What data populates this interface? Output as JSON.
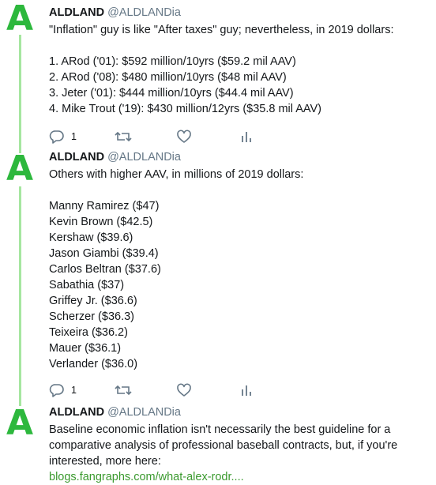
{
  "colors": {
    "accent": "#2db83d",
    "thread_line": "#a6e6a0",
    "link": "#3b9a2f",
    "muted": "#657786"
  },
  "tweets": [
    {
      "avatar_letter": "A",
      "name": "ALDLAND",
      "handle": "@ALDLANDia",
      "lines": [
        "\"Inflation\" guy is like \"After taxes\" guy; nevertheless, in 2019 dollars:",
        "",
        "1. ARod ('01): $592 million/10yrs ($59.2 mil AAV)",
        "2. ARod ('08): $480 million/10yrs ($48 mil AAV)",
        "3. Jeter ('01): $444 million/10yrs ($44.4 mil AAV)",
        "4. Mike Trout ('19): $430 million/12yrs ($35.8 mil AAV)"
      ],
      "reply_count": "1",
      "icons": [
        "reply-icon",
        "retweet-icon",
        "like-icon",
        "analytics-icon"
      ]
    },
    {
      "avatar_letter": "A",
      "name": "ALDLAND",
      "handle": "@ALDLANDia",
      "lines": [
        "Others with higher AAV, in millions of 2019 dollars:",
        "",
        "Manny Ramirez ($47)",
        "Kevin Brown ($42.5)",
        "Kershaw ($39.6)",
        "Jason Giambi ($39.4)",
        "Carlos Beltran ($37.6)",
        "Sabathia ($37)",
        "Griffey Jr. ($36.6)",
        "Scherzer ($36.3)",
        "Teixeira ($36.2)",
        "Mauer ($36.1)",
        "Verlander ($36.0)"
      ],
      "reply_count": "1",
      "icons": [
        "reply-icon",
        "retweet-icon",
        "like-icon",
        "analytics-icon"
      ]
    },
    {
      "avatar_letter": "A",
      "name": "ALDLAND",
      "handle": "@ALDLANDia",
      "text": "Baseline economic inflation isn't necessarily the best guideline for a comparative analysis of professional baseball contracts, but, if you're interested, more here:",
      "link_text": "blogs.fangraphs.com/what-alex-rodr...."
    }
  ]
}
